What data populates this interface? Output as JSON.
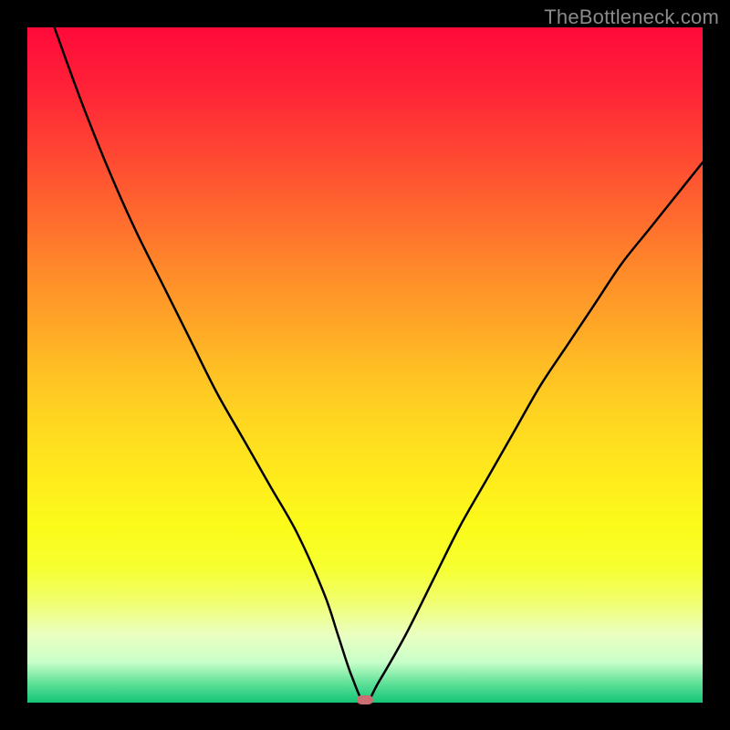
{
  "watermark": "TheBottleneck.com",
  "chart_data": {
    "type": "line",
    "title": "",
    "xlabel": "",
    "ylabel": "",
    "xlim": [
      0,
      100
    ],
    "ylim": [
      0,
      100
    ],
    "grid": false,
    "series": [
      {
        "name": "curve",
        "x": [
          4,
          8,
          12,
          16,
          20,
          24,
          28,
          32,
          36,
          40,
          44,
          46,
          48,
          50,
          52,
          56,
          60,
          64,
          68,
          72,
          76,
          80,
          84,
          88,
          92,
          96,
          100
        ],
        "values": [
          100,
          89,
          79,
          70,
          62,
          54,
          46,
          39,
          32,
          25,
          16,
          10,
          4,
          0,
          3,
          10,
          18,
          26,
          33,
          40,
          47,
          53,
          59,
          65,
          70,
          75,
          80
        ]
      }
    ],
    "minimum_marker": {
      "x": 50,
      "y": 0
    },
    "background": {
      "type": "vertical-gradient",
      "stops": [
        {
          "pos": 0,
          "color": "#ff0a3a"
        },
        {
          "pos": 18,
          "color": "#ff4433"
        },
        {
          "pos": 36,
          "color": "#ff8a2a"
        },
        {
          "pos": 52,
          "color": "#ffc423"
        },
        {
          "pos": 68,
          "color": "#ffee1c"
        },
        {
          "pos": 85,
          "color": "#f1ff6e"
        },
        {
          "pos": 94,
          "color": "#c9ffc9"
        },
        {
          "pos": 100,
          "color": "#13c576"
        }
      ]
    }
  }
}
